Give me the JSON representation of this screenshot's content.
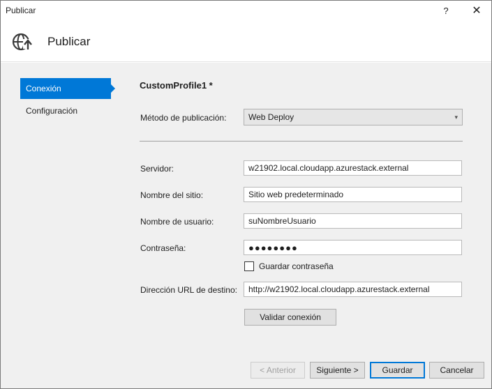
{
  "window": {
    "title": "Publicar",
    "help_glyph": "?",
    "close_glyph": "✕"
  },
  "header": {
    "title": "Publicar",
    "icon": "globe-publish-icon"
  },
  "nav": {
    "items": [
      {
        "label": "Conexión",
        "active": true
      },
      {
        "label": "Configuración",
        "active": false
      }
    ]
  },
  "profile": {
    "name": "CustomProfile1 *"
  },
  "form": {
    "method_label": "Método de publicación:",
    "method_value": "Web Deploy",
    "server_label": "Servidor:",
    "server_value": "w21902.local.cloudapp.azurestack.external",
    "site_label": "Nombre del sitio:",
    "site_value": "Sitio web predeterminado",
    "user_label": "Nombre de usuario:",
    "user_value": "suNombreUsuario",
    "password_label": "Contraseña:",
    "password_value": "●●●●●●●●",
    "save_password_label": "Guardar contraseña",
    "save_password_checked": false,
    "url_label": "Dirección URL de destino:",
    "url_value": "http://w21902.local.cloudapp.azurestack.external",
    "validate_label": "Validar conexión"
  },
  "footer": {
    "prev_label": "< Anterior",
    "next_label": "Siguiente >",
    "save_label": "Guardar",
    "cancel_label": "Cancelar"
  },
  "colors": {
    "accent": "#0078d7",
    "panel_bg": "#f0f0f0"
  }
}
